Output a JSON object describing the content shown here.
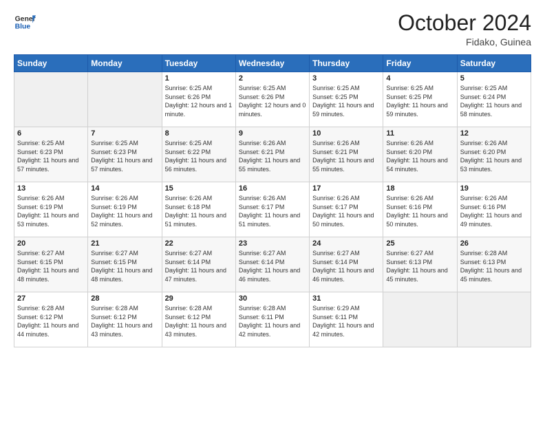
{
  "header": {
    "logo_line1": "General",
    "logo_line2": "Blue",
    "month": "October 2024",
    "location": "Fidako, Guinea"
  },
  "weekdays": [
    "Sunday",
    "Monday",
    "Tuesday",
    "Wednesday",
    "Thursday",
    "Friday",
    "Saturday"
  ],
  "weeks": [
    [
      {
        "day": "",
        "sunrise": "",
        "sunset": "",
        "daylight": ""
      },
      {
        "day": "",
        "sunrise": "",
        "sunset": "",
        "daylight": ""
      },
      {
        "day": "1",
        "sunrise": "Sunrise: 6:25 AM",
        "sunset": "Sunset: 6:26 PM",
        "daylight": "Daylight: 12 hours and 1 minute."
      },
      {
        "day": "2",
        "sunrise": "Sunrise: 6:25 AM",
        "sunset": "Sunset: 6:26 PM",
        "daylight": "Daylight: 12 hours and 0 minutes."
      },
      {
        "day": "3",
        "sunrise": "Sunrise: 6:25 AM",
        "sunset": "Sunset: 6:25 PM",
        "daylight": "Daylight: 11 hours and 59 minutes."
      },
      {
        "day": "4",
        "sunrise": "Sunrise: 6:25 AM",
        "sunset": "Sunset: 6:25 PM",
        "daylight": "Daylight: 11 hours and 59 minutes."
      },
      {
        "day": "5",
        "sunrise": "Sunrise: 6:25 AM",
        "sunset": "Sunset: 6:24 PM",
        "daylight": "Daylight: 11 hours and 58 minutes."
      }
    ],
    [
      {
        "day": "6",
        "sunrise": "Sunrise: 6:25 AM",
        "sunset": "Sunset: 6:23 PM",
        "daylight": "Daylight: 11 hours and 57 minutes."
      },
      {
        "day": "7",
        "sunrise": "Sunrise: 6:25 AM",
        "sunset": "Sunset: 6:23 PM",
        "daylight": "Daylight: 11 hours and 57 minutes."
      },
      {
        "day": "8",
        "sunrise": "Sunrise: 6:25 AM",
        "sunset": "Sunset: 6:22 PM",
        "daylight": "Daylight: 11 hours and 56 minutes."
      },
      {
        "day": "9",
        "sunrise": "Sunrise: 6:26 AM",
        "sunset": "Sunset: 6:21 PM",
        "daylight": "Daylight: 11 hours and 55 minutes."
      },
      {
        "day": "10",
        "sunrise": "Sunrise: 6:26 AM",
        "sunset": "Sunset: 6:21 PM",
        "daylight": "Daylight: 11 hours and 55 minutes."
      },
      {
        "day": "11",
        "sunrise": "Sunrise: 6:26 AM",
        "sunset": "Sunset: 6:20 PM",
        "daylight": "Daylight: 11 hours and 54 minutes."
      },
      {
        "day": "12",
        "sunrise": "Sunrise: 6:26 AM",
        "sunset": "Sunset: 6:20 PM",
        "daylight": "Daylight: 11 hours and 53 minutes."
      }
    ],
    [
      {
        "day": "13",
        "sunrise": "Sunrise: 6:26 AM",
        "sunset": "Sunset: 6:19 PM",
        "daylight": "Daylight: 11 hours and 53 minutes."
      },
      {
        "day": "14",
        "sunrise": "Sunrise: 6:26 AM",
        "sunset": "Sunset: 6:19 PM",
        "daylight": "Daylight: 11 hours and 52 minutes."
      },
      {
        "day": "15",
        "sunrise": "Sunrise: 6:26 AM",
        "sunset": "Sunset: 6:18 PM",
        "daylight": "Daylight: 11 hours and 51 minutes."
      },
      {
        "day": "16",
        "sunrise": "Sunrise: 6:26 AM",
        "sunset": "Sunset: 6:17 PM",
        "daylight": "Daylight: 11 hours and 51 minutes."
      },
      {
        "day": "17",
        "sunrise": "Sunrise: 6:26 AM",
        "sunset": "Sunset: 6:17 PM",
        "daylight": "Daylight: 11 hours and 50 minutes."
      },
      {
        "day": "18",
        "sunrise": "Sunrise: 6:26 AM",
        "sunset": "Sunset: 6:16 PM",
        "daylight": "Daylight: 11 hours and 50 minutes."
      },
      {
        "day": "19",
        "sunrise": "Sunrise: 6:26 AM",
        "sunset": "Sunset: 6:16 PM",
        "daylight": "Daylight: 11 hours and 49 minutes."
      }
    ],
    [
      {
        "day": "20",
        "sunrise": "Sunrise: 6:27 AM",
        "sunset": "Sunset: 6:15 PM",
        "daylight": "Daylight: 11 hours and 48 minutes."
      },
      {
        "day": "21",
        "sunrise": "Sunrise: 6:27 AM",
        "sunset": "Sunset: 6:15 PM",
        "daylight": "Daylight: 11 hours and 48 minutes."
      },
      {
        "day": "22",
        "sunrise": "Sunrise: 6:27 AM",
        "sunset": "Sunset: 6:14 PM",
        "daylight": "Daylight: 11 hours and 47 minutes."
      },
      {
        "day": "23",
        "sunrise": "Sunrise: 6:27 AM",
        "sunset": "Sunset: 6:14 PM",
        "daylight": "Daylight: 11 hours and 46 minutes."
      },
      {
        "day": "24",
        "sunrise": "Sunrise: 6:27 AM",
        "sunset": "Sunset: 6:14 PM",
        "daylight": "Daylight: 11 hours and 46 minutes."
      },
      {
        "day": "25",
        "sunrise": "Sunrise: 6:27 AM",
        "sunset": "Sunset: 6:13 PM",
        "daylight": "Daylight: 11 hours and 45 minutes."
      },
      {
        "day": "26",
        "sunrise": "Sunrise: 6:28 AM",
        "sunset": "Sunset: 6:13 PM",
        "daylight": "Daylight: 11 hours and 45 minutes."
      }
    ],
    [
      {
        "day": "27",
        "sunrise": "Sunrise: 6:28 AM",
        "sunset": "Sunset: 6:12 PM",
        "daylight": "Daylight: 11 hours and 44 minutes."
      },
      {
        "day": "28",
        "sunrise": "Sunrise: 6:28 AM",
        "sunset": "Sunset: 6:12 PM",
        "daylight": "Daylight: 11 hours and 43 minutes."
      },
      {
        "day": "29",
        "sunrise": "Sunrise: 6:28 AM",
        "sunset": "Sunset: 6:12 PM",
        "daylight": "Daylight: 11 hours and 43 minutes."
      },
      {
        "day": "30",
        "sunrise": "Sunrise: 6:28 AM",
        "sunset": "Sunset: 6:11 PM",
        "daylight": "Daylight: 11 hours and 42 minutes."
      },
      {
        "day": "31",
        "sunrise": "Sunrise: 6:29 AM",
        "sunset": "Sunset: 6:11 PM",
        "daylight": "Daylight: 11 hours and 42 minutes."
      },
      {
        "day": "",
        "sunrise": "",
        "sunset": "",
        "daylight": ""
      },
      {
        "day": "",
        "sunrise": "",
        "sunset": "",
        "daylight": ""
      }
    ]
  ]
}
